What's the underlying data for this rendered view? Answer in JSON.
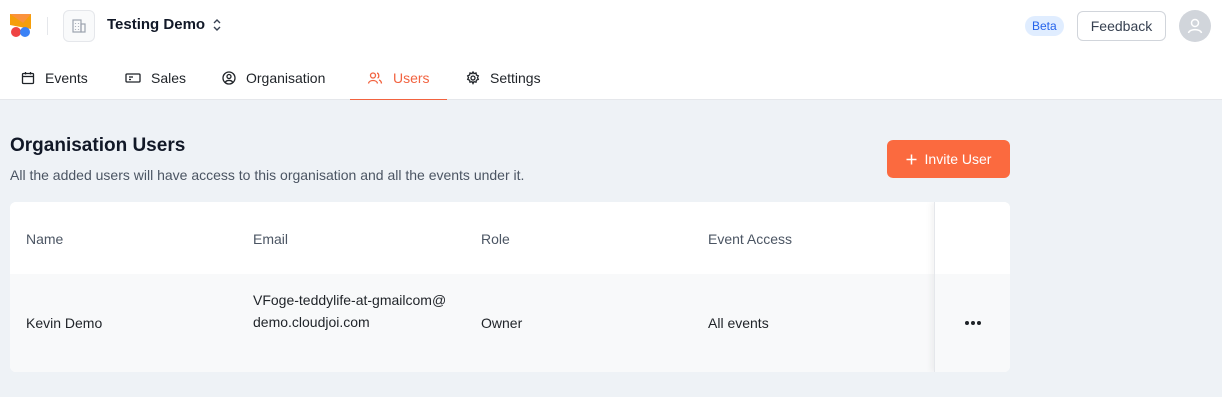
{
  "header": {
    "org_name": "Testing Demo",
    "beta_badge": "Beta",
    "feedback_label": "Feedback"
  },
  "tabs": [
    {
      "label": "Events",
      "icon": "calendar-icon"
    },
    {
      "label": "Sales",
      "icon": "ticket-icon"
    },
    {
      "label": "Organisation",
      "icon": "user-circle-icon"
    },
    {
      "label": "Users",
      "icon": "users-icon",
      "active": true
    },
    {
      "label": "Settings",
      "icon": "gear-icon"
    }
  ],
  "page": {
    "title": "Organisation Users",
    "subtitle": "All the added users will have access to this organisation and all the events under it.",
    "invite_label": "Invite User"
  },
  "table": {
    "columns": [
      "Name",
      "Email",
      "Role",
      "Event Access"
    ],
    "rows": [
      {
        "name": "Kevin Demo",
        "email": "VFoge-teddylife-at-gmailcom@demo.cloudjoi.com",
        "role": "Owner",
        "access": "All events"
      }
    ]
  },
  "colors": {
    "accent": "#f26340",
    "button": "#fb6a3f",
    "background": "#eef2f6"
  }
}
